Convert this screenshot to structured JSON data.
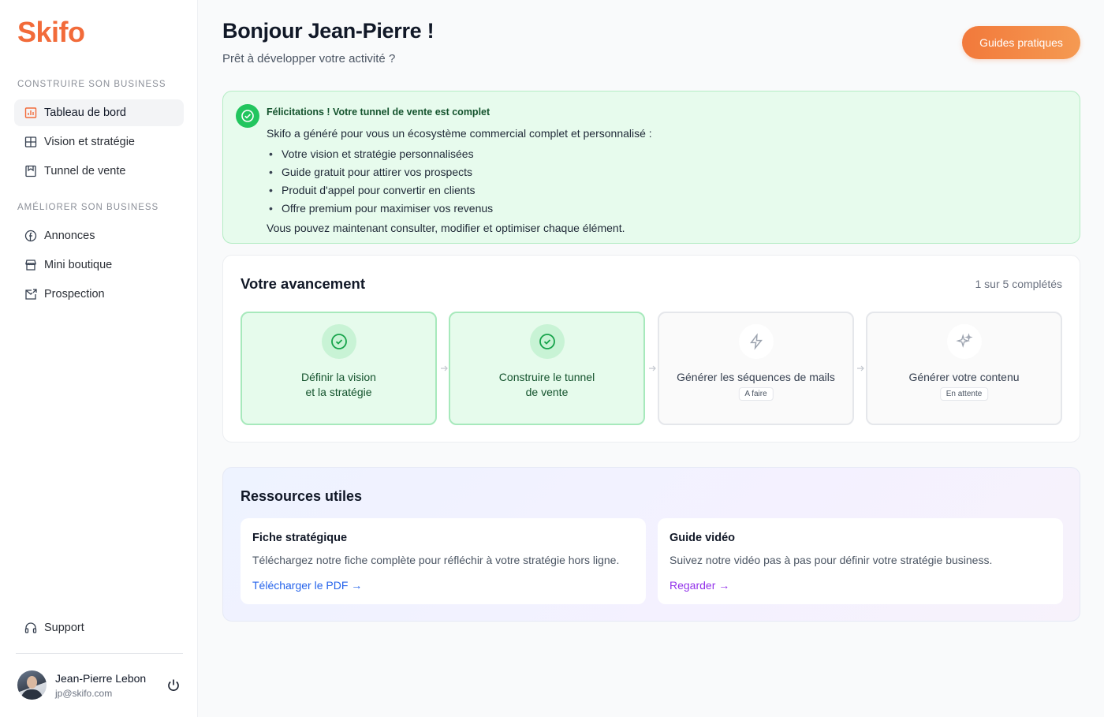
{
  "app": {
    "logo": "Skifo"
  },
  "sidebar": {
    "section1": "CONSTRUIRE SON BUSINESS",
    "section2": "AMÉLIORER SON BUSINESS",
    "items": [
      {
        "label": "Tableau de bord",
        "icon": "bar-chart-icon"
      },
      {
        "label": "Vision et stratégie",
        "icon": "grid-icon"
      },
      {
        "label": "Tunnel de vente",
        "icon": "bookmark-icon"
      },
      {
        "label": "Annonces",
        "icon": "facebook-icon"
      },
      {
        "label": "Mini boutique",
        "icon": "store-icon"
      },
      {
        "label": "Prospection",
        "icon": "mail-send-icon"
      }
    ],
    "support": "Support",
    "user": {
      "name": "Jean-Pierre Lebon",
      "email": "jp@skifo.com"
    }
  },
  "header": {
    "greeting": "Bonjour Jean-Pierre !",
    "subtitle": "Prêt à développer votre activité ?",
    "guides_button": "Guides pratiques"
  },
  "success": {
    "title": "Félicitations ! Votre tunnel de vente est complet",
    "intro": "Skifo a généré pour vous un écosystème commercial complet et personnalisé :",
    "bullets": [
      "Votre vision et stratégie personnalisées",
      "Guide gratuit pour attirer vos prospects",
      "Produit d'appel pour convertir en clients",
      "Offre premium pour maximiser vos revenus"
    ],
    "outro": "Vous pouvez maintenant consulter, modifier et optimiser chaque élément."
  },
  "progress": {
    "title": "Votre avancement",
    "count": "1 sur 5 complétés",
    "steps": [
      {
        "line1": "Définir la vision",
        "line2": "et la stratégie",
        "status": "done"
      },
      {
        "line1": "Construire le tunnel",
        "line2": "de vente",
        "status": "done"
      },
      {
        "line1": "Générer les séquences de mails",
        "badge": "A faire",
        "status": "todo"
      },
      {
        "line1": "Générer votre contenu",
        "badge": "En attente",
        "status": "todo"
      }
    ]
  },
  "resources": {
    "title": "Ressources utiles",
    "cards": [
      {
        "title": "Fiche stratégique",
        "desc": "Téléchargez notre fiche complète pour réfléchir à votre stratégie hors ligne.",
        "link": "Télécharger le PDF →",
        "link_color": "#2563eb"
      },
      {
        "title": "Guide vidéo",
        "desc": "Suivez notre vidéo pas à pas pour définir votre stratégie business.",
        "link": "Regarder →",
        "link_color": "#9333ea"
      }
    ]
  },
  "colors": {
    "accent": "#f26b3a",
    "success": "#22c55e"
  }
}
